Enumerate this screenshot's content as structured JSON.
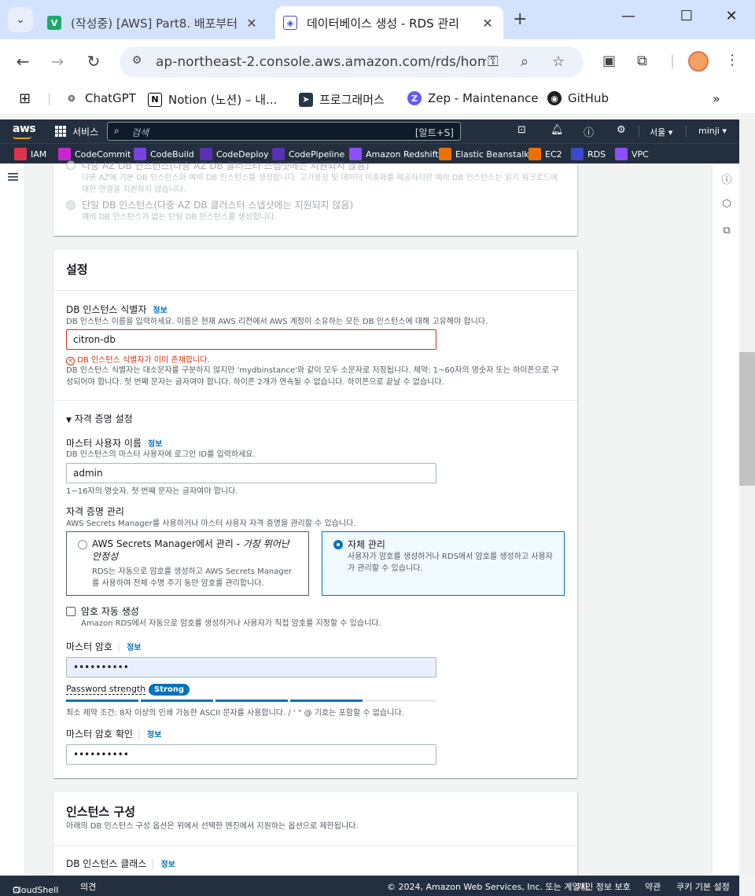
{
  "browser": {
    "tabs": [
      {
        "title": "(작성중) [AWS] Part8. 배포부터",
        "favicon": "V"
      },
      {
        "title": "데이터베이스 생성 - RDS 관리",
        "favicon": "rds"
      }
    ],
    "url": "ap-northeast-2.console.aws.amazon.com/rds/hom...",
    "bookmarks": [
      "ChatGPT",
      "Notion (노션) – 내...",
      "프로그래머스",
      "Zep - Maintenance",
      "GitHub"
    ]
  },
  "aws": {
    "logo": "aws",
    "services_label": "서비스",
    "search_placeholder": "검색",
    "search_hotkey": "[알트+S]",
    "region": "서울",
    "user": "minji",
    "favorites": [
      "IAM",
      "CodeCommit",
      "CodeBuild",
      "CodeDeploy",
      "CodePipeline",
      "Amazon Redshift",
      "Elastic Beanstalk",
      "EC2",
      "RDS",
      "VPC"
    ]
  },
  "availability": {
    "multi_az_title": "다중 AZ DB 인스턴스(다중 AZ DB 클러스터 스냅샷에는 지원되지 않음)",
    "multi_az_desc": "다른 AZ에 기본 DB 인스턴스와 예비 DB 인스턴스를 생성합니다. 고가용성 및 데이터 이중화를 제공하지만 예비 DB 인스턴스는 읽기 워크로드에 대한 연결을 지원하지 않습니다.",
    "single_title": "단일 DB 인스턴스(다중 AZ DB 클러스터 스냅샷에는 지원되지 않음)",
    "single_desc": "예비 DB 인스턴스가 없는 단일 DB 인스턴스를 생성합니다."
  },
  "settings": {
    "title": "설정",
    "info": "정보",
    "identifier_label": "DB 인스턴스 식별자",
    "identifier_desc": "DB 인스턴스 이름을 입력하세요. 이름은 현재 AWS 리전에서 AWS 계정이 소유하는 모든 DB 인스턴스에 대해 고유해야 합니다.",
    "identifier_value": "citron-db",
    "identifier_error": "DB 인스턴스 식별자가 이미 존재합니다.",
    "identifier_help": "DB 인스턴스 식별자는 대소문자를 구분하지 않지만 'mydbinstance'와 같이 모두 소문자로 저장됩니다. 제약: 1~60자의 영숫자 또는 하이픈으로 구성되어야 합니다. 첫 번째 문자는 글자여야 합니다. 하이픈 2개가 연속될 수 없습니다. 하이픈으로 끝날 수 없습니다.",
    "credentials_toggle": "자격 증명 설정",
    "master_user_label": "마스터 사용자 이름",
    "master_user_desc": "DB 인스턴스의 마스터 사용자에 로그인 ID를 입력하세요.",
    "master_user_value": "admin",
    "master_user_help": "1~16자의 영숫자. 첫 번째 문자는 글자여야 합니다.",
    "cred_mgmt_label": "자격 증명 관리",
    "cred_mgmt_desc": "AWS Secrets Manager를 사용하거나 마스터 사용자 자격 증명을 관리할 수 있습니다.",
    "option_secrets_title": "AWS Secrets Manager에서 관리 - ",
    "option_secrets_title_em": "가장 뛰어난 안정성",
    "option_secrets_desc": "RDS는 자동으로 암호를 생성하고 AWS Secrets Manager를 사용하여 전체 수명 주기 동안 암호를 관리합니다.",
    "option_self_title": "자체 관리",
    "option_self_desc": "사용자가 암호를 생성하거나 RDS에서 암호를 생성하고 사용자가 관리할 수 있습니다.",
    "autogen_label": "암호 자동 생성",
    "autogen_desc": "Amazon RDS에서 자동으로 암호를 생성하거나 사용자가 직접 암호를 지정할 수 있습니다.",
    "master_pw_label": "마스터 암호",
    "master_pw_value": "••••••••••",
    "strength_label": "Password strength",
    "strength_badge": "Strong",
    "strength_level": 0.85,
    "pw_help": "최소 제약 조건: 8자 이상의 인쇄 가능한 ASCII 문자를 사용합니다. / ' \" @ 기호는 포함할 수 없습니다.",
    "confirm_pw_label": "마스터 암호 확인",
    "confirm_pw_value": "••••••••••"
  },
  "instance": {
    "title": "인스턴스 구성",
    "desc": "아래의 DB 인스턴스 구성 옵션은 위에서 선택한 엔진에서 지원하는 옵션으로 제한됩니다.",
    "class_label": "DB 인스턴스 클래스",
    "info": "정보"
  },
  "footer": {
    "cloudshell": "CloudShell",
    "feedback": "의견",
    "copyright": "© 2024, Amazon Web Services, Inc. 또는 계열사.",
    "privacy": "개인 정보 보호",
    "terms": "약관",
    "cookies": "쿠키 기본 설정"
  },
  "colors": {
    "link": "#0073bb",
    "error": "#d13212",
    "header": "#232f3e",
    "accent": "#ff9900"
  }
}
